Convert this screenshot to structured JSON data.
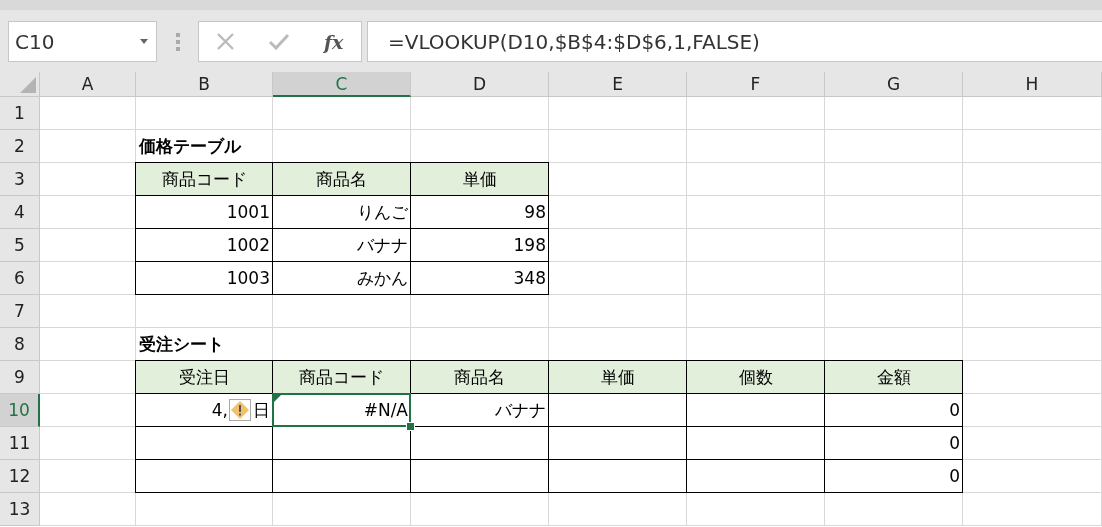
{
  "name_box": {
    "value": "C10"
  },
  "formula_bar": {
    "function_label": "fx",
    "formula": "=VLOOKUP(D10,$B$4:$D$6,1,FALSE)"
  },
  "columns": [
    {
      "label": "A",
      "selected": false
    },
    {
      "label": "B",
      "selected": false
    },
    {
      "label": "C",
      "selected": true
    },
    {
      "label": "D",
      "selected": false
    },
    {
      "label": "E",
      "selected": false
    },
    {
      "label": "F",
      "selected": false
    },
    {
      "label": "G",
      "selected": false
    },
    {
      "label": "H",
      "selected": false
    }
  ],
  "rows": [
    {
      "label": "1",
      "selected": false
    },
    {
      "label": "2",
      "selected": false
    },
    {
      "label": "3",
      "selected": false
    },
    {
      "label": "4",
      "selected": false
    },
    {
      "label": "5",
      "selected": false
    },
    {
      "label": "6",
      "selected": false
    },
    {
      "label": "7",
      "selected": false
    },
    {
      "label": "8",
      "selected": false
    },
    {
      "label": "9",
      "selected": false
    },
    {
      "label": "10",
      "selected": true
    },
    {
      "label": "11",
      "selected": false
    },
    {
      "label": "12",
      "selected": false
    },
    {
      "label": "13",
      "selected": false
    }
  ],
  "tables": [
    {
      "title": "価格テーブル",
      "headers": [
        "商品コード",
        "商品名",
        "単価"
      ],
      "rows": [
        [
          "1001",
          "りんご",
          "98"
        ],
        [
          "1002",
          "バナナ",
          "198"
        ],
        [
          "1003",
          "みかん",
          "348"
        ]
      ]
    },
    {
      "title": "受注シート",
      "headers": [
        "受注日",
        "商品コード",
        "商品名",
        "単価",
        "個数",
        "金額"
      ],
      "rows": [
        [
          {
            "kind": "warning",
            "parts": [
              "4,",
              "日"
            ]
          },
          {
            "kind": "value",
            "text": "#N/A",
            "selected": true,
            "error_flag": true
          },
          "バナナ",
          null,
          null,
          "0"
        ],
        [
          null,
          null,
          null,
          null,
          null,
          "0"
        ],
        [
          null,
          null,
          null,
          null,
          null,
          "0"
        ]
      ]
    }
  ]
}
